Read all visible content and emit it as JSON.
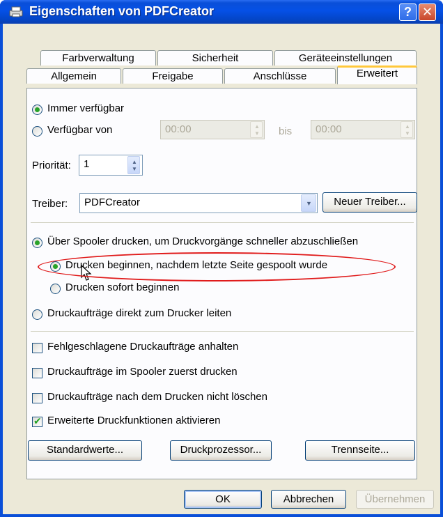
{
  "window": {
    "title": "Eigenschaften von PDFCreator",
    "help_button": "?",
    "close_button": "X"
  },
  "tabs": {
    "row1": [
      "Farbverwaltung",
      "Sicherheit",
      "Geräteeinstellungen"
    ],
    "row2": [
      "Allgemein",
      "Freigabe",
      "Anschlüsse",
      "Erweitert"
    ],
    "active": "Erweitert"
  },
  "availability": {
    "always_label": "Immer verfügbar",
    "from_label": "Verfügbar von",
    "from_time": "00:00",
    "until_label": "bis",
    "until_time": "00:00",
    "selected": "always"
  },
  "priority": {
    "label": "Priorität:",
    "value": "1"
  },
  "driver": {
    "label": "Treiber:",
    "value": "PDFCreator",
    "new_driver_button": "Neuer Treiber..."
  },
  "spool": {
    "spool_label": "Über Spooler drucken, um Druckvorgänge schneller abzuschließen",
    "after_last_page_label": "Drucken beginnen, nachdem letzte Seite gespoolt wurde",
    "immediately_label": "Drucken sofort beginnen",
    "direct_label": "Druckaufträge direkt zum Drucker leiten",
    "selected_main": "spool",
    "selected_sub": "after_last_page"
  },
  "options": [
    {
      "label": "Fehlgeschlagene Druckaufträge anhalten",
      "checked": false
    },
    {
      "label": "Druckaufträge im Spooler zuerst drucken",
      "checked": false
    },
    {
      "label": "Druckaufträge nach dem Drucken nicht löschen",
      "checked": false
    },
    {
      "label": "Erweiterte Druckfunktionen aktivieren",
      "checked": true
    }
  ],
  "bottom_buttons": {
    "defaults": "Standardwerte...",
    "processor": "Druckprozessor...",
    "separator_page": "Trennseite..."
  },
  "dialog_buttons": {
    "ok": "OK",
    "cancel": "Abbrechen",
    "apply": "Übernehmen"
  },
  "colors": {
    "title_bar": "#0a4fd8",
    "highlight_ellipse": "#e01b1b",
    "active_tab_accent": "#ffc83c"
  }
}
